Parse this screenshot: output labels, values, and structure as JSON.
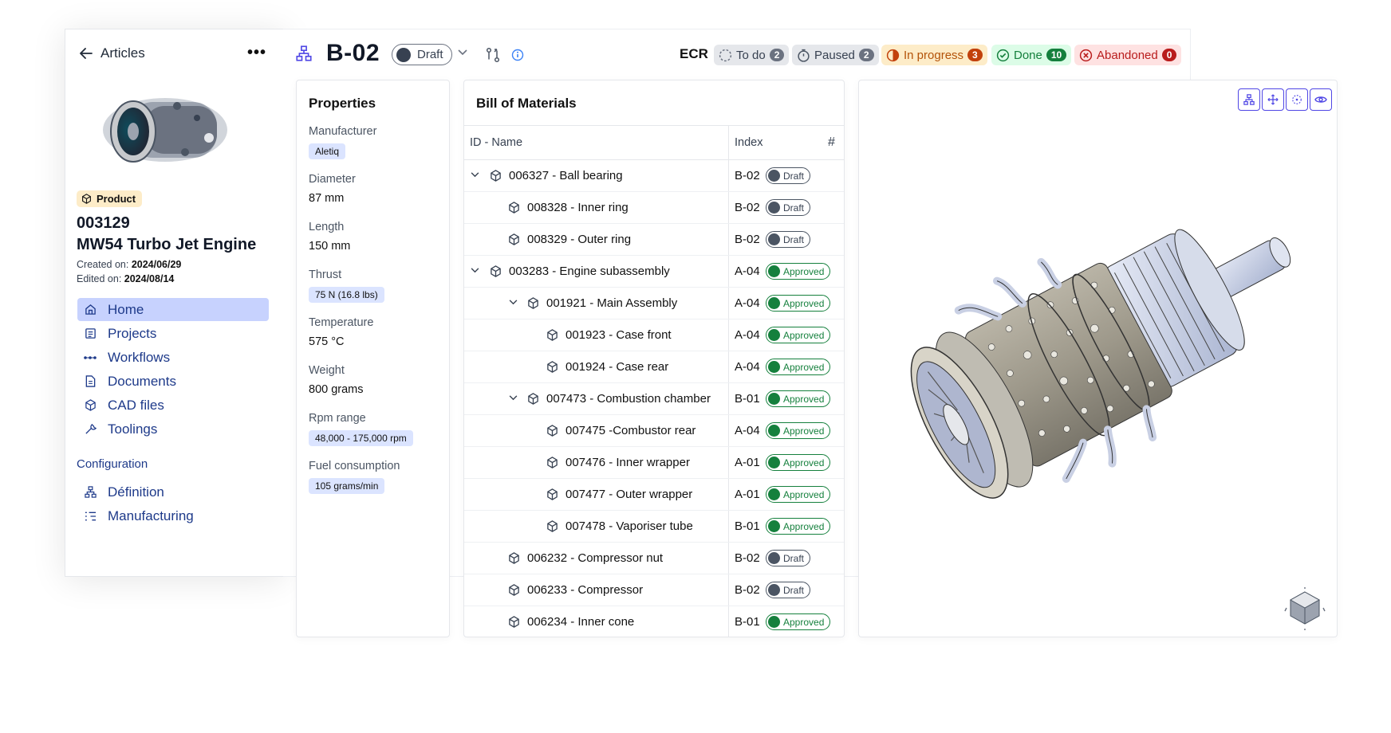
{
  "sidebar": {
    "back_label": "Articles",
    "more_label": "•••",
    "product_badge": "Product",
    "product_id": "003129",
    "product_name": "MW54 Turbo Jet Engine",
    "created_label": "Created on:",
    "created_value": "2024/06/29",
    "edited_label": "Edited on:",
    "edited_value": "2024/08/14",
    "nav": [
      {
        "label": "Home",
        "icon": "home-icon",
        "active": true
      },
      {
        "label": "Projects",
        "icon": "projects-icon"
      },
      {
        "label": "Workflows",
        "icon": "workflows-icon"
      },
      {
        "label": "Documents",
        "icon": "document-icon"
      },
      {
        "label": "CAD files",
        "icon": "cube-icon"
      },
      {
        "label": "Toolings",
        "icon": "wrench-icon"
      }
    ],
    "config_heading": "Configuration",
    "config_nav": [
      {
        "label": "Définition",
        "icon": "hierarchy-icon"
      },
      {
        "label": "Manufacturing",
        "icon": "list-steps-icon"
      }
    ]
  },
  "header": {
    "code": "B-02",
    "status": "Draft",
    "ecr_label": "ECR",
    "ecr_statuses": [
      {
        "label": "To do",
        "count": "2",
        "bg": "#e5e7eb",
        "fg": "#374151",
        "cnt_bg": "#6b7280"
      },
      {
        "label": "Paused",
        "count": "2",
        "bg": "#e5e7eb",
        "fg": "#374151",
        "cnt_bg": "#6b7280"
      },
      {
        "label": "In progress",
        "count": "3",
        "bg": "#fdecc8",
        "fg": "#b45309",
        "cnt_bg": "#c2410c"
      },
      {
        "label": "Done",
        "count": "10",
        "bg": "#dcfce7",
        "fg": "#15803d",
        "cnt_bg": "#15803d"
      },
      {
        "label": "Abandoned",
        "count": "0",
        "bg": "#fee2e2",
        "fg": "#b91c1c",
        "cnt_bg": "#b91c1c"
      }
    ]
  },
  "properties": {
    "title": "Properties",
    "items": [
      {
        "label": "Manufacturer",
        "value": "Aletiq",
        "tag": true
      },
      {
        "label": "Diameter",
        "value": "87 mm",
        "tag": false
      },
      {
        "label": "Length",
        "value": "150 mm",
        "tag": false
      },
      {
        "label": "Thrust",
        "value": "75 N (16.8 lbs)",
        "tag": true
      },
      {
        "label": "Temperature",
        "value": "575 °C",
        "tag": false
      },
      {
        "label": "Weight",
        "value": "800 grams",
        "tag": false
      },
      {
        "label": "Rpm range",
        "value": "48,000 - 175,000 rpm",
        "tag": true
      },
      {
        "label": "Fuel consumption",
        "value": "105 grams/min",
        "tag": true
      }
    ]
  },
  "bom": {
    "title": "Bill of Materials",
    "col_name": "ID - Name",
    "col_index": "Index",
    "col_hash": "#",
    "rows": [
      {
        "name": "006327 - Ball bearing",
        "index": "B-02",
        "status": "Draft",
        "level": 0,
        "expander": true
      },
      {
        "name": "008328 - Inner ring",
        "index": "B-02",
        "status": "Draft",
        "level": 1,
        "expander": false
      },
      {
        "name": "008329 - Outer ring",
        "index": "B-02",
        "status": "Draft",
        "level": 1,
        "expander": false
      },
      {
        "name": "003283 - Engine subassembly",
        "index": "A-04",
        "status": "Approved",
        "level": 0,
        "expander": true
      },
      {
        "name": "001921 - Main Assembly",
        "index": "A-04",
        "status": "Approved",
        "level": 1,
        "expander": true
      },
      {
        "name": "001923 - Case front",
        "index": "A-04",
        "status": "Approved",
        "level": 2,
        "expander": false
      },
      {
        "name": "001924 - Case rear",
        "index": "A-04",
        "status": "Approved",
        "level": 2,
        "expander": false
      },
      {
        "name": "007473 - Combustion chamber",
        "index": "B-01",
        "status": "Approved",
        "level": 1,
        "expander": true
      },
      {
        "name": "007475 -Combustor rear",
        "index": "A-04",
        "status": "Approved",
        "level": 2,
        "expander": false
      },
      {
        "name": "007476 - Inner wrapper",
        "index": "A-01",
        "status": "Approved",
        "level": 2,
        "expander": false
      },
      {
        "name": "007477 - Outer wrapper",
        "index": "A-01",
        "status": "Approved",
        "level": 2,
        "expander": false
      },
      {
        "name": "007478 - Vaporiser tube",
        "index": "B-01",
        "status": "Approved",
        "level": 2,
        "expander": false
      },
      {
        "name": "006232 - Compressor nut",
        "index": "B-02",
        "status": "Draft",
        "level": 1,
        "expander": false
      },
      {
        "name": "006233 - Compressor",
        "index": "B-02",
        "status": "Draft",
        "level": 1,
        "expander": false
      },
      {
        "name": "006234 - Inner cone",
        "index": "B-01",
        "status": "Approved",
        "level": 1,
        "expander": false
      }
    ]
  },
  "viewer": {
    "tools": [
      "hierarchy-icon",
      "move-icon",
      "explode-icon",
      "eye-icon"
    ],
    "cube_label": "view-cube"
  }
}
